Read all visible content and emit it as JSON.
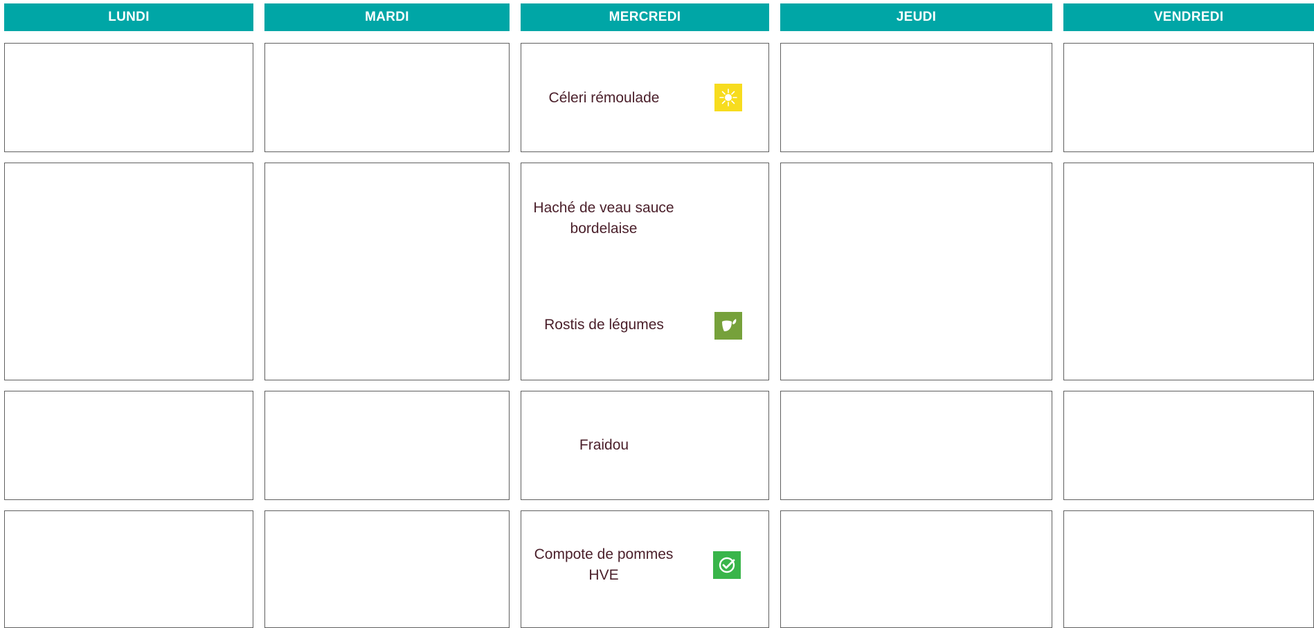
{
  "days": [
    "LUNDI",
    "MARDI",
    "MERCREDI",
    "JEUDI",
    "VENDREDI"
  ],
  "colors": {
    "header_bg": "#00a6a6",
    "header_text": "#ffffff",
    "cell_border": "#5f5f5f",
    "item_text": "#4a1f2a",
    "badge_seasonal": "#f7dc1e",
    "badge_vegetarian": "#76a13b",
    "badge_certified": "#39b54a"
  },
  "mercredi": {
    "starter": {
      "name": "Céleri rémoulade",
      "badge": "sun-icon"
    },
    "main": {
      "name": "Haché de veau sauce bordelaise"
    },
    "side": {
      "name": "Rostis de légumes",
      "badge": "leaf-icon"
    },
    "cheese": {
      "name": "Fraidou"
    },
    "dessert": {
      "name": "Compote de pommes HVE",
      "badge": "check-circle-icon"
    }
  }
}
